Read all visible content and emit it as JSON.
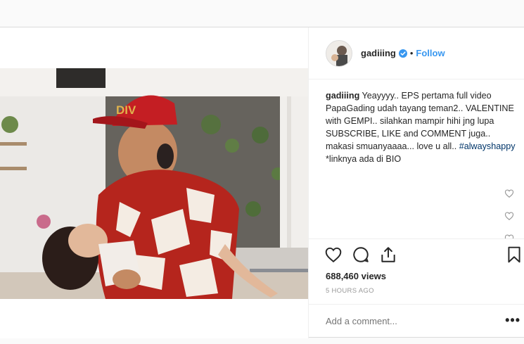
{
  "header": {
    "username": "gadiiing",
    "separator": "•",
    "follow_label": "Follow"
  },
  "caption": {
    "username": "gadiiing",
    "text_before": " Yeayyyy.. EPS pertama full video PapaGading udah tayang teman2.. VALENTINE with GEMPI.. silahkan mampir hihi jng lupa SUBSCRIBE, LIKE and COMMENT juga.. makasi smuanyaaaa... love u all.. ",
    "hashtag": "#alwayshappy",
    "text_after": " *linknya ada di BIO"
  },
  "stats": {
    "views": "688,460 views",
    "time": "5 HOURS AGO"
  },
  "comment": {
    "placeholder": "Add a comment...",
    "more": "•••"
  },
  "media": {
    "cap_text": "DIV"
  },
  "colors": {
    "link": "#3897f0",
    "hashtag": "#003569",
    "verified": "#3897f0",
    "shirt_red": "#b5251d",
    "cap_red": "#c41e23"
  },
  "icons": [
    "verified-badge-icon",
    "heart-icon",
    "comment-icon",
    "share-icon",
    "bookmark-icon",
    "small-heart-icon",
    "more-options-icon"
  ]
}
